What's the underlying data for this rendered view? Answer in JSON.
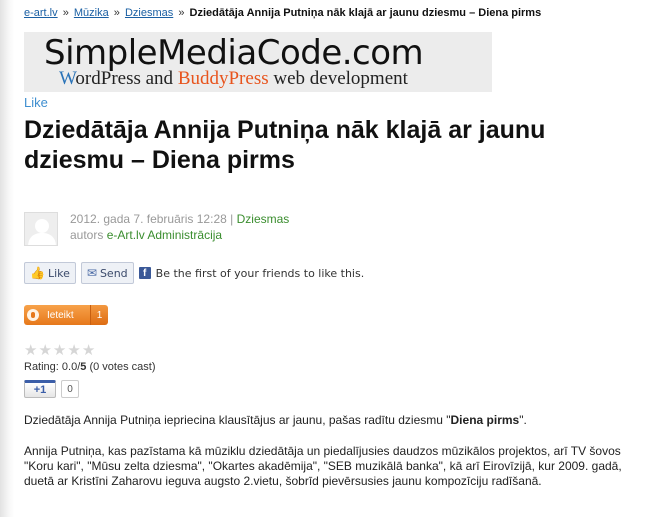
{
  "breadcrumb": {
    "home": "e-art.lv",
    "sep": "»",
    "cat1": "Mūzika",
    "cat2": "Dziesmas",
    "current": "Dziedātāja Annija Putniņa nāk klajā ar jaunu dziesmu – Diena pirms"
  },
  "banner": {
    "logo_main": "SimpleMediaCode.com",
    "sub_w": "W",
    "sub_word1": "ordPress and ",
    "sub_buddy": "BuddyPress",
    "sub_rest": " web development"
  },
  "like_link": "Like",
  "post": {
    "title": "Dziedātāja Annija Putniņa nāk klajā ar jaunu dziesmu – Diena pirms",
    "date": "2012. gada 7. februāris 12:28",
    "meta_sep": "|",
    "category": "Dziesmas",
    "author_prefix": "autors",
    "author": "e-Art.lv Administrācija"
  },
  "facebook": {
    "like_label": "Like",
    "send_label": "Send",
    "social_text": "Be the first of your friends to like this."
  },
  "ieteikt": {
    "label": "Ieteikt",
    "count": "1"
  },
  "rating": {
    "stars": [
      "★",
      "★",
      "★",
      "★",
      "★"
    ],
    "label": "Rating: ",
    "value": "0.0",
    "slash": "/",
    "max": "5",
    "votes": " (0 votes cast)"
  },
  "gplus": {
    "label": "+1",
    "count": "0"
  },
  "body": {
    "p1_before": "Dziedātāja Annija Putniņa iepriecina klausītājus ar jaunu, pašas radītu dziesmu \"",
    "p1_bold": "Diena pirms",
    "p1_after": "\".",
    "p2": "Annija Putniņa, kas pazīstama kā mūziklu dziedātāja un piedalījusies daudzos mūzikālos projektos, arī TV šovos \"Koru kari\", \"Mūsu zelta dziesma\", \"Okartes akadēmija\", \"SEB muzikālā banka\", kā arī Eirovīzijā, kur 2009. gadā, duetā ar Kristīni Zaharovu ieguva augsto 2.vietu, šobrīd pievērsusies jaunu kompozīciju radīšanā."
  },
  "colors": {
    "link_blue": "#1a5fa3",
    "meta_green": "#3a8d2e",
    "ieteikt_orange": "#e6781b",
    "facebook_blue": "#3b5998"
  }
}
